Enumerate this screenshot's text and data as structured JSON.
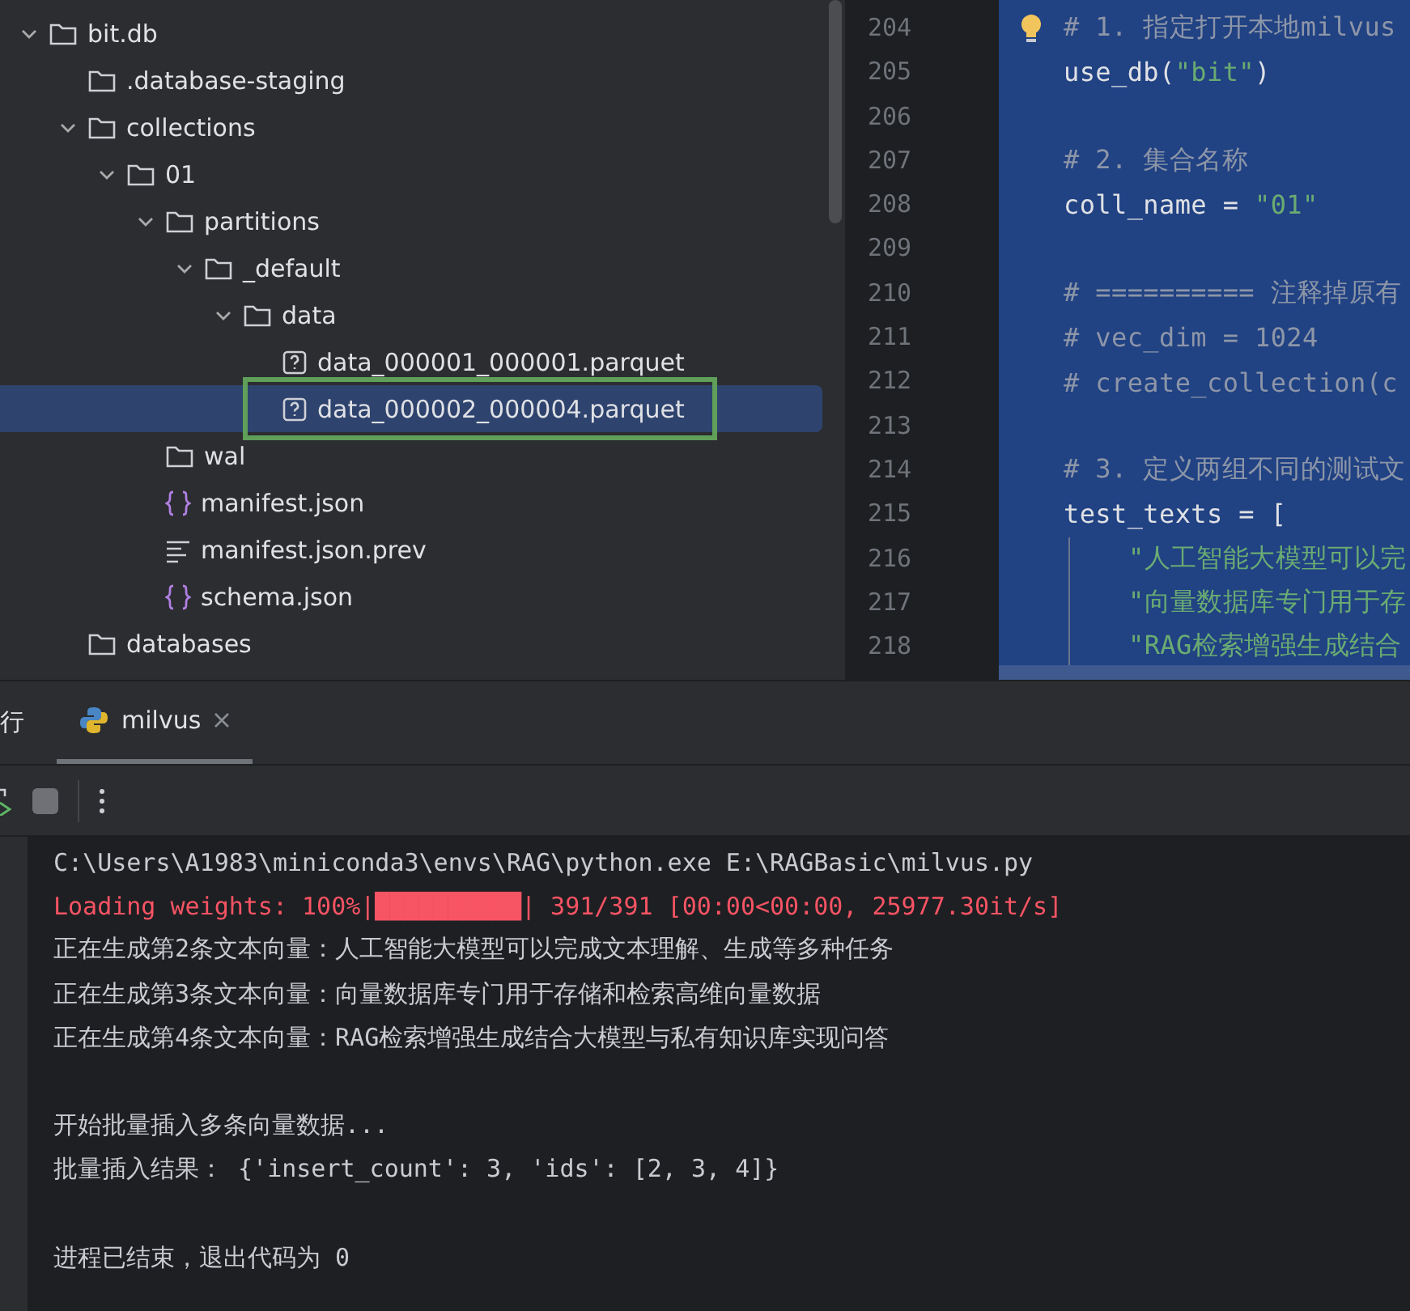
{
  "project_tree": [
    {
      "name": "bit.db",
      "kind": "folder",
      "expanded": true,
      "selected": false,
      "boxed": false,
      "children": [
        {
          "name": ".database-staging",
          "kind": "folder",
          "selected": false,
          "boxed": false
        },
        {
          "name": "collections",
          "kind": "folder",
          "expanded": true,
          "selected": false,
          "boxed": false,
          "children": [
            {
              "name": "01",
              "kind": "folder",
              "expanded": true,
              "selected": false,
              "boxed": false,
              "children": [
                {
                  "name": "partitions",
                  "kind": "folder",
                  "expanded": true,
                  "selected": false,
                  "boxed": false,
                  "children": [
                    {
                      "name": "_default",
                      "kind": "folder",
                      "expanded": true,
                      "selected": false,
                      "boxed": false,
                      "children": [
                        {
                          "name": "data",
                          "kind": "folder",
                          "expanded": true,
                          "selected": false,
                          "boxed": false,
                          "children": [
                            {
                              "name": "data_000001_000001.parquet",
                              "kind": "unknown",
                              "selected": false,
                              "boxed": false
                            },
                            {
                              "name": "data_000002_000004.parquet",
                              "kind": "unknown",
                              "selected": true,
                              "boxed": true
                            }
                          ]
                        }
                      ]
                    }
                  ]
                },
                {
                  "name": "wal",
                  "kind": "folder",
                  "selected": false,
                  "boxed": false
                },
                {
                  "name": "manifest.json",
                  "kind": "json",
                  "selected": false,
                  "boxed": false
                },
                {
                  "name": "manifest.json.prev",
                  "kind": "text",
                  "selected": false,
                  "boxed": false
                },
                {
                  "name": "schema.json",
                  "kind": "json",
                  "selected": false,
                  "boxed": false
                }
              ]
            }
          ]
        },
        {
          "name": "databases",
          "kind": "folder",
          "selected": false,
          "boxed": false
        }
      ]
    }
  ],
  "editor": {
    "lines": [
      {
        "number": "204",
        "hint": true,
        "tokens": [
          {
            "kind": "comment",
            "text": "# 1. 指定打开本地milvus"
          }
        ]
      },
      {
        "number": "205",
        "tokens": [
          {
            "kind": "code",
            "text": "use_db("
          },
          {
            "kind": "string",
            "text": "\"bit\""
          },
          {
            "kind": "code",
            "text": ")"
          }
        ]
      },
      {
        "number": "206"
      },
      {
        "number": "207",
        "tokens": [
          {
            "kind": "comment",
            "text": "# 2. 集合名称"
          }
        ]
      },
      {
        "number": "208",
        "tokens": [
          {
            "kind": "code",
            "text": "coll_name = "
          },
          {
            "kind": "string",
            "text": "\"01\""
          }
        ]
      },
      {
        "number": "209"
      },
      {
        "number": "210",
        "tokens": [
          {
            "kind": "comment",
            "text": "# ========== 注释掉原有"
          }
        ]
      },
      {
        "number": "211",
        "tokens": [
          {
            "kind": "comment",
            "text": "# vec_dim = 1024"
          }
        ]
      },
      {
        "number": "212",
        "tokens": [
          {
            "kind": "comment",
            "text": "# create_collection(c"
          }
        ]
      },
      {
        "number": "213"
      },
      {
        "number": "214",
        "tokens": [
          {
            "kind": "comment",
            "text": "# 3. 定义两组不同的测试文"
          }
        ]
      },
      {
        "number": "215",
        "tokens": [
          {
            "kind": "code",
            "text": "test_texts = ["
          }
        ]
      },
      {
        "number": "216",
        "indented": true,
        "tokens": [
          {
            "kind": "string",
            "text": "\"人工智能大模型可以完"
          }
        ]
      },
      {
        "number": "217",
        "indented": true,
        "tokens": [
          {
            "kind": "string",
            "text": "\"向量数据库专门用于存"
          }
        ]
      },
      {
        "number": "218",
        "indented": true,
        "tokens": [
          {
            "kind": "string",
            "text": "\"RAG检索增强生成结合"
          }
        ]
      }
    ]
  },
  "run_panel": {
    "title": "行",
    "tabs": [
      {
        "label": "milvus",
        "selected": true
      }
    ],
    "console": [
      {
        "kind": "normal",
        "text": "C:\\Users\\A1983\\miniconda3\\envs\\RAG\\python.exe E:\\RAGBasic\\milvus.py"
      },
      {
        "kind": "error",
        "text": "Loading weights: 100%|██████████| 391/391 [00:00<00:00, 25977.30it/s]"
      },
      {
        "kind": "normal",
        "text": "正在生成第2条文本向量：人工智能大模型可以完成文本理解、生成等多种任务"
      },
      {
        "kind": "normal",
        "text": "正在生成第3条文本向量：向量数据库专门用于存储和检索高维向量数据"
      },
      {
        "kind": "normal",
        "text": "正在生成第4条文本向量：RAG检索增强生成结合大模型与私有知识库实现问答"
      },
      {
        "kind": "blank"
      },
      {
        "kind": "normal",
        "text": "开始批量插入多条向量数据..."
      },
      {
        "kind": "normal",
        "text": "批量插入结果： {'insert_count': 3, 'ids': [2, 3, 4]}"
      },
      {
        "kind": "blank"
      },
      {
        "kind": "normal",
        "text": "进程已结束，退出代码为 0"
      }
    ]
  }
}
